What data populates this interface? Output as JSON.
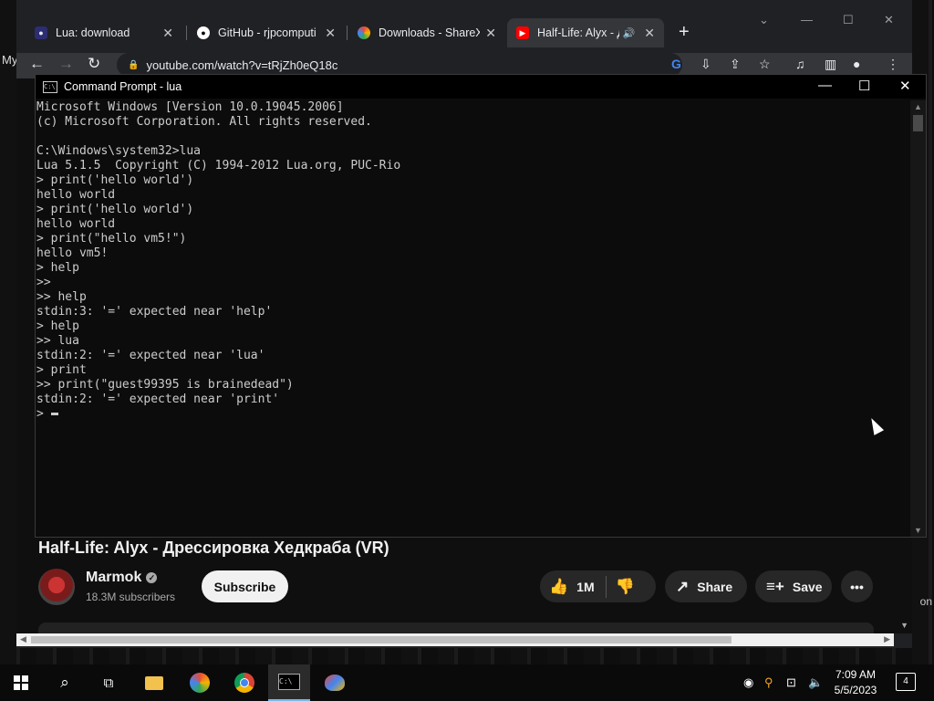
{
  "desktop": {
    "left_label": "My",
    "right_label": "on"
  },
  "browser": {
    "tabs": [
      {
        "title": "Lua: download",
        "favicon": "lua-icon",
        "color": "#2c2d72"
      },
      {
        "title": "GitHub - rjpcomputi",
        "favicon": "github-icon",
        "color": "#ffffff"
      },
      {
        "title": "Downloads - ShareX",
        "favicon": "sharex-icon",
        "color": "#e94a3b"
      },
      {
        "title": "Half-Life: Alyx - Д",
        "favicon": "youtube-icon",
        "color": "#ff0000"
      }
    ],
    "url": "youtube.com/watch?v=tRjZh0eQ18c"
  },
  "youtube": {
    "video_title": "Half-Life: Alyx - Дрессировка Хедкраба (VR)",
    "channel_name": "Marmok",
    "subscribers": "18.3M subscribers",
    "subscribe_label": "Subscribe",
    "like_count": "1M",
    "share_label": "Share",
    "save_label": "Save"
  },
  "cmd": {
    "title": "Command Prompt - lua",
    "lines": [
      "Microsoft Windows [Version 10.0.19045.2006]",
      "(c) Microsoft Corporation. All rights reserved.",
      "",
      "C:\\Windows\\system32>lua",
      "Lua 5.1.5  Copyright (C) 1994-2012 Lua.org, PUC-Rio",
      "> print('hello world')",
      "hello world",
      "> print('hello world')",
      "hello world",
      "> print(\"hello vm5!\")",
      "hello vm5!",
      "> help",
      ">>",
      ">> help",
      "stdin:3: '=' expected near 'help'",
      "> help",
      ">> lua",
      "stdin:2: '=' expected near 'lua'",
      "> print",
      ">> print(\"guest99395 is brainedead\")",
      "stdin:2: '=' expected near 'print'"
    ],
    "prompt": "> "
  },
  "taskbar": {
    "time": "7:09 AM",
    "date": "5/5/2023",
    "notification_count": "4"
  }
}
